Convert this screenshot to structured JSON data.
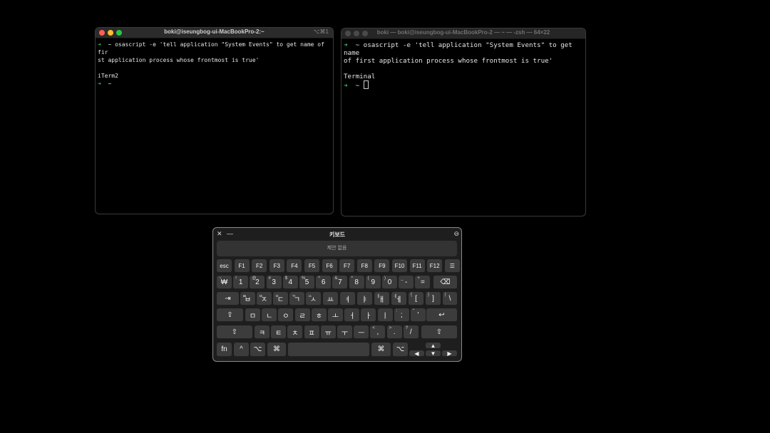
{
  "terminal_left": {
    "title": "boki@iseungbog-ui-MacBookPro-2:~",
    "shortcut": "⌥⌘1",
    "line1_arrow": "➜",
    "line1": "  ~ osascript -e 'tell application \"System Events\" to get name of fir",
    "line2": "st application process whose frontmost is true'",
    "output": "iTerm2",
    "prompt_arrow": "➜",
    "prompt": "  ~"
  },
  "terminal_right": {
    "title": "boki — boki@iseungbog-ui-MacBookPro-2 — ~ — -zsh — 64×22",
    "line1_arrow": "➜",
    "line1": "  ~ osascript -e 'tell application \"System Events\" to get name",
    "line2": "of first application process whose frontmost is true'",
    "output": "Terminal",
    "prompt_arrow": "➜",
    "prompt": "  ~ "
  },
  "keyboard": {
    "title": "키보드",
    "close": "✕",
    "minimize": "—",
    "options": "⊖",
    "suggestion": "제안 없음",
    "row_fn": [
      "esc",
      "F1",
      "F2",
      "F3",
      "F4",
      "F5",
      "F6",
      "F7",
      "F8",
      "F9",
      "F10",
      "F11",
      "F12",
      "☰"
    ],
    "row_num": [
      {
        "main": "₩",
        "sup": "~"
      },
      {
        "main": "1",
        "sup": "!"
      },
      {
        "main": "2",
        "sup": "@"
      },
      {
        "main": "3",
        "sup": "#"
      },
      {
        "main": "4",
        "sup": "$"
      },
      {
        "main": "5",
        "sup": "%"
      },
      {
        "main": "6",
        "sup": "^"
      },
      {
        "main": "7",
        "sup": "&"
      },
      {
        "main": "8",
        "sup": "*"
      },
      {
        "main": "9",
        "sup": "("
      },
      {
        "main": "0",
        "sup": ")"
      },
      {
        "main": "-",
        "sup": "_"
      },
      {
        "main": "=",
        "sup": "+"
      },
      {
        "main": "⌫",
        "sup": ""
      }
    ],
    "row_q": [
      {
        "main": "⇥",
        "sup": ""
      },
      {
        "main": "ㅂ",
        "sup": "ㅃ"
      },
      {
        "main": "ㅈ",
        "sup": "ㅉ"
      },
      {
        "main": "ㄷ",
        "sup": "ㄸ"
      },
      {
        "main": "ㄱ",
        "sup": "ㄲ"
      },
      {
        "main": "ㅅ",
        "sup": "ㅆ"
      },
      {
        "main": "ㅛ",
        "sup": ""
      },
      {
        "main": "ㅕ",
        "sup": ""
      },
      {
        "main": "ㅑ",
        "sup": ""
      },
      {
        "main": "ㅐ",
        "sup": "ㅒ"
      },
      {
        "main": "ㅔ",
        "sup": "ㅖ"
      },
      {
        "main": "[",
        "sup": "{"
      },
      {
        "main": "]",
        "sup": "}"
      },
      {
        "main": "\\",
        "sup": "|"
      }
    ],
    "row_a": [
      {
        "main": "⇪",
        "sup": ""
      },
      {
        "main": "ㅁ",
        "sup": ""
      },
      {
        "main": "ㄴ",
        "sup": ""
      },
      {
        "main": "ㅇ",
        "sup": ""
      },
      {
        "main": "ㄹ",
        "sup": ""
      },
      {
        "main": "ㅎ",
        "sup": ""
      },
      {
        "main": "ㅗ",
        "sup": ""
      },
      {
        "main": "ㅓ",
        "sup": ""
      },
      {
        "main": "ㅏ",
        "sup": ""
      },
      {
        "main": "ㅣ",
        "sup": ""
      },
      {
        "main": ";",
        "sup": ":"
      },
      {
        "main": "'",
        "sup": "\""
      },
      {
        "main": "↩",
        "sup": ""
      }
    ],
    "row_z": [
      {
        "main": "⇧",
        "sup": ""
      },
      {
        "main": "ㅋ",
        "sup": ""
      },
      {
        "main": "ㅌ",
        "sup": ""
      },
      {
        "main": "ㅊ",
        "sup": ""
      },
      {
        "main": "ㅍ",
        "sup": ""
      },
      {
        "main": "ㅠ",
        "sup": ""
      },
      {
        "main": "ㅜ",
        "sup": ""
      },
      {
        "main": "ㅡ",
        "sup": ""
      },
      {
        "main": ",",
        "sup": "<"
      },
      {
        "main": ".",
        "sup": ">"
      },
      {
        "main": "/",
        "sup": "?"
      },
      {
        "main": "⇧",
        "sup": ""
      }
    ],
    "row_bottom": [
      {
        "main": "fn"
      },
      {
        "main": "^"
      },
      {
        "main": "⌥"
      },
      {
        "main": "⌘"
      },
      {
        "main": ""
      },
      {
        "main": "⌘"
      },
      {
        "main": "⌥"
      }
    ],
    "arrows": {
      "up": "▲",
      "left": "◀",
      "down": "▼",
      "right": "▶"
    },
    "colors": {
      "close": "#ff5f57",
      "minimize": "#febc2e",
      "zoom": "#28c840",
      "inactive_light": "#4a4a4a",
      "prompt_arrow": "#3fc26a"
    }
  }
}
